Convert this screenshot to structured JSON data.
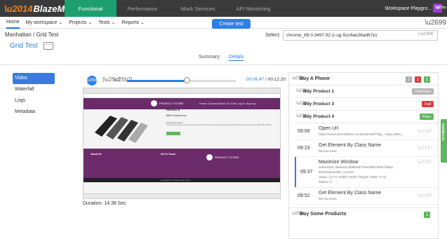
{
  "app": {
    "logo": "BlazeMeter"
  },
  "product_tabs": [
    "Functional",
    "Performance",
    "Mock Services",
    "API Monitoring"
  ],
  "workspace": {
    "name": "Workspace Playgro...",
    "initial": "W"
  },
  "nav": {
    "home": "Home",
    "items": [
      "My workspace ⌄",
      "Projects ⌄",
      "Tests ⌄",
      "Reports ⌄"
    ]
  },
  "create_test": "Create test",
  "breadcrumb": "Manhattan / Grid Test",
  "test_title": "Grid Test",
  "more_icon": "⋯",
  "select": {
    "label": "Select:",
    "value": "chrome_69.0.3497.92 (r-sg-5cc9ae28ad67e)"
  },
  "subtabs": {
    "summary": "Summary",
    "details": "Details"
  },
  "left_nav": [
    "Video",
    "Waterfall",
    "Logs",
    "Metadata"
  ],
  "player": {
    "current": "00:06:47",
    "total": "/ 00:12:20",
    "progress": 0.55
  },
  "video_frame": {
    "store": "PRODUCT STORE",
    "nav": "Home  Contact  About Us  Cart  Log in  Sign up",
    "product": "Nexus 6",
    "price": "$650 *includes tax",
    "description_heading": "Product description",
    "description": "The Motorola Google Nexus 6 is powered by 2.7GHz quad-core Qualcomm Snapdragon 805 processor and it comes with 3GB of RAM.",
    "about": "About Us",
    "contact": "Get In Touch",
    "copyright": "Copyright © Product Store 2017"
  },
  "duration": "Duration: 14.38 Sec",
  "right": {
    "phone_title": "Buy A Phone",
    "phone_badges": [
      {
        "v": "3",
        "c": "#aaaaaa"
      },
      {
        "v": "1",
        "c": "#d93b3b"
      },
      {
        "v": "1",
        "c": "#5cb85c"
      }
    ],
    "products": [
      {
        "name": "Buy Product 1",
        "status": "Unknown",
        "color": "#b5b5b5"
      },
      {
        "name": "Buy Product 3",
        "status": "Fail",
        "color": "#d93b3b"
      },
      {
        "name": "Buy Product 4",
        "status": "Pass",
        "color": "#5cb85c"
      }
    ],
    "steps": [
      {
        "time": "09:06",
        "name": "Open Url",
        "sub": "https://www.demoblaze.com/prod.html?idp_=4&a=debu..."
      },
      {
        "time": "09:23",
        "name": "Get Element By Class Name",
        "sub": "btn-success"
      },
      {
        "time": "09:37",
        "name": "Maximize Window",
        "sub1": "SessionId: 09d4e4c3b8b30f7434c89b75fd47dda5",
        "sub2": "WindowHandle: current",
        "sub3": "Value: {\"y\":0,\"width\":1920,\"height\":1058,\"x\":0}",
        "sub4": "Status: 0"
      },
      {
        "time": "09:52",
        "name": "Get Element By Class Name",
        "sub": "btn-success"
      }
    ],
    "bottom_title": "Buy Some Products",
    "bottom_badge": "1"
  },
  "feedback": "FEEDBACK",
  "colors": {
    "accent": "#2b7fe8",
    "functional_tab": "#1e9f72",
    "topbar": "#3a3a3a",
    "brand_purple": "#6b2b6b"
  }
}
